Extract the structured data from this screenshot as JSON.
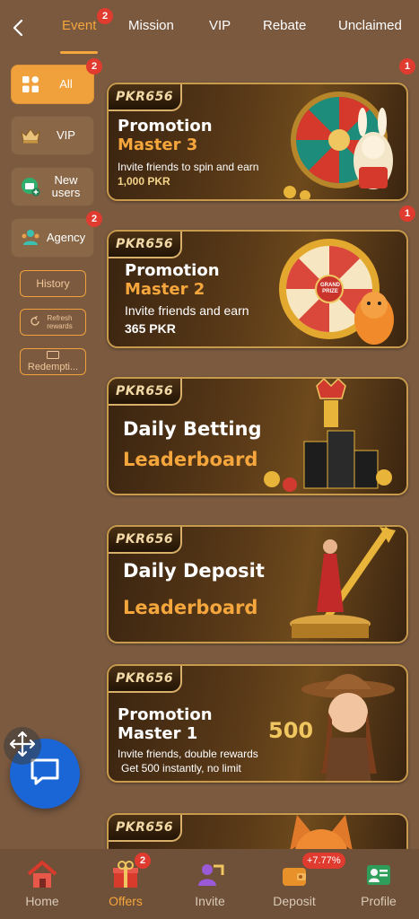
{
  "header": {
    "tabs": [
      {
        "label": "Event",
        "badge": "2"
      },
      {
        "label": "Mission"
      },
      {
        "label": "VIP"
      },
      {
        "label": "Rebate"
      },
      {
        "label": "Unclaimed"
      }
    ]
  },
  "sidebar": {
    "items": [
      {
        "label": "All",
        "badge": "2",
        "icon": "grid-icon"
      },
      {
        "label": "VIP",
        "icon": "crown-icon"
      },
      {
        "label": "New users",
        "icon": "new-user-icon"
      },
      {
        "label": "Agency",
        "badge": "2",
        "icon": "agency-icon"
      }
    ],
    "history_label": "History",
    "refresh_label": "Refresh rewards",
    "redemption_label": "Redempti..."
  },
  "cards": [
    {
      "logo": "PKR656",
      "title": "Promotion",
      "subtitle": "Master 3",
      "desc": "Invite friends to spin and earn",
      "amount": "1,000 PKR",
      "badge": "1"
    },
    {
      "logo": "PKR656",
      "title": "Promotion",
      "subtitle": "Master 2",
      "desc": "Invite friends and earn",
      "amount": "365 PKR",
      "badge": "1",
      "wheel_text": "GRAND PRIZE"
    },
    {
      "logo": "PKR656",
      "title": "Daily Betting",
      "subtitle": "Leaderboard"
    },
    {
      "logo": "PKR656",
      "title": "Daily Deposit",
      "subtitle": "Leaderboard"
    },
    {
      "logo": "PKR656",
      "title": "Promotion",
      "subtitle": "Master 1",
      "desc": "Invite friends, double rewards",
      "amount": "Get 500 instantly, no limit",
      "big_number": "500"
    },
    {
      "logo": "PKR656"
    }
  ],
  "bottom_nav": [
    {
      "label": "Home",
      "icon": "home-icon"
    },
    {
      "label": "Offers",
      "icon": "gift-icon",
      "badge": "2"
    },
    {
      "label": "Invite",
      "icon": "invite-icon"
    },
    {
      "label": "Deposit",
      "icon": "wallet-icon",
      "badge": "+7.77%"
    },
    {
      "label": "Profile",
      "icon": "profile-icon"
    }
  ],
  "colors": {
    "accent": "#f5a63c",
    "background": "#7b5a40",
    "badge": "#e03b2f",
    "chat": "#1a66d6"
  }
}
